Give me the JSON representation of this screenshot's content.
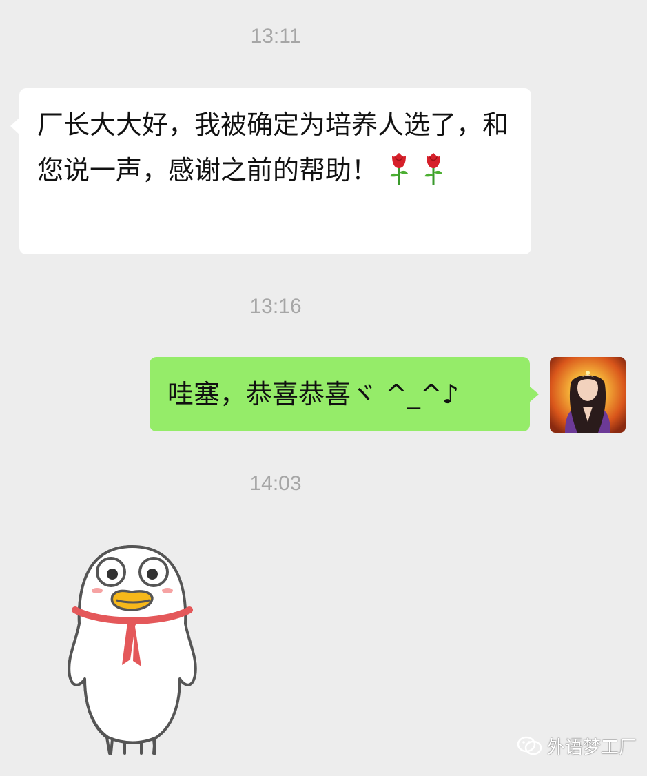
{
  "chat": {
    "messages": [
      {
        "timestamp": "13:11",
        "text": "厂长大大好，我被确定为培养人选了，和您说一声，感谢之前的帮助！",
        "emoji": [
          "rose-emoji",
          "rose-emoji"
        ]
      },
      {
        "timestamp": "13:16",
        "text": "哇塞，恭喜恭喜ヾ ^_^♪"
      },
      {
        "timestamp": "14:03",
        "sticker": "white-duck-sticker"
      }
    ]
  },
  "watermark": {
    "icon": "wechat-official-account-icon",
    "text": "外语梦工厂"
  },
  "colors": {
    "background": "#ededed",
    "incoming_bubble": "#ffffff",
    "outgoing_bubble": "#95ec69",
    "timestamp": "#a6a6a6"
  }
}
